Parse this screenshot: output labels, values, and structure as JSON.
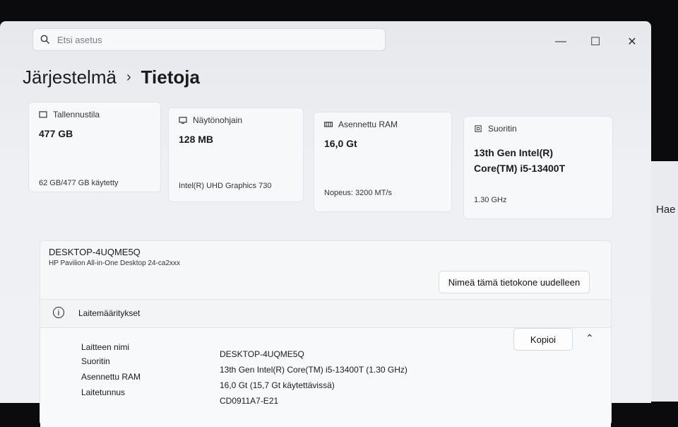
{
  "search": {
    "placeholder": "Etsi asetus"
  },
  "window_controls": {
    "minimize": "—",
    "maximize": "☐",
    "close": "✕"
  },
  "breadcrumb": {
    "parent": "Järjestelmä",
    "separator": "›",
    "current": "Tietoja"
  },
  "cards": [
    {
      "label": "Tallennustila",
      "value": "477 GB",
      "sub": "62 GB/477 GB käytetty",
      "icon": "storage-icon"
    },
    {
      "label": "Näytönohjain",
      "value": "128 MB",
      "sub": "Intel(R) UHD Graphics 730",
      "icon": "gpu-icon"
    },
    {
      "label": "Asennettu RAM",
      "value": "16,0 Gt",
      "sub": "Nopeus: 3200 MT/s",
      "icon": "ram-icon"
    },
    {
      "label": "Suoritin",
      "value": "13th Gen Intel(R)\nCore(TM) i5-13400T",
      "sub": "1.30 GHz",
      "icon": "cpu-icon"
    }
  ],
  "device": {
    "name": "DESKTOP-4UQME5Q",
    "model": "HP Pavilion All-in-One Desktop 24-ca2xxx",
    "rename_button": "Nimeä tämä tietokone uudelleen"
  },
  "specs": {
    "title": "Laitemääritykset",
    "copy_button": "Kopioi",
    "rows": [
      {
        "label": "Laitteen nimi",
        "value": "DESKTOP-4UQME5Q"
      },
      {
        "label": "Suoritin",
        "value": "13th Gen Intel(R) Core(TM) i5-13400T (1.30 GHz)"
      },
      {
        "label": "Asennettu RAM",
        "value": "16,0 Gt (15,7 Gt käytettävissä)"
      },
      {
        "label": "Laitetunnus",
        "value": "CD0911A7-E21"
      }
    ]
  },
  "background": {
    "text": "Hae"
  }
}
